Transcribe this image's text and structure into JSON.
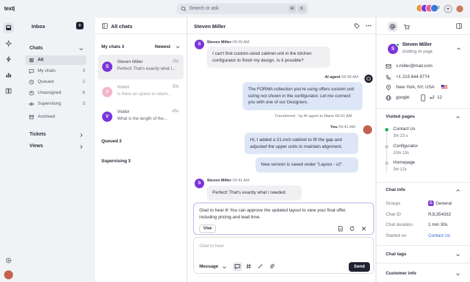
{
  "app": {
    "logo": "text|"
  },
  "search": {
    "placeholder": "Search or ask",
    "key1": "⌘",
    "key2": "K"
  },
  "topbar": {
    "online_count": "99",
    "add_label": "+"
  },
  "colors": {
    "accent": "#7b35d8",
    "send": "#1f2230",
    "visitor_pink": "#f3b6c9",
    "visitor_purple": "#7b35d8",
    "link": "#2a63d6",
    "green": "#1fb05a"
  },
  "rail_icons": [
    "inbox-icon",
    "sparkle-icon",
    "bolt-icon",
    "chart-icon",
    "book-icon",
    "settings-icon",
    "user-avatar"
  ],
  "nav": {
    "title": "Inbox",
    "chats_label": "Chats",
    "items": [
      {
        "label": "All",
        "count": "",
        "icon": "list-icon"
      },
      {
        "label": "My chats",
        "count": "3",
        "icon": "chat-icon"
      },
      {
        "label": "Queued",
        "count": "2",
        "icon": "clock-icon"
      },
      {
        "label": "Unassigned",
        "count": "6",
        "icon": "person-icon"
      },
      {
        "label": "Supervising",
        "count": "3",
        "icon": "eye-icon"
      },
      {
        "label": "Archived",
        "count": "",
        "icon": "archive-icon"
      }
    ],
    "tickets_label": "Tickets",
    "views_label": "Views"
  },
  "chat_list": {
    "title": "All chats",
    "my_chats_label": "My chats 3",
    "sort_label": "Newest",
    "cards": [
      {
        "initial": "S",
        "name": "Steven Miller",
        "time": "15s",
        "preview": "Perfect! That's exactly what I..."
      },
      {
        "initial": "V",
        "name": "Visitor",
        "time": "30s",
        "preview": "Is there an option to return..."
      },
      {
        "initial": "V",
        "name": "Visitor",
        "time": "45s",
        "preview": "What is the length of the..."
      }
    ],
    "queued_label": "Queued 2",
    "supervising_label": "Supervising 3"
  },
  "conversation": {
    "title": "Steven Miller",
    "messages": [
      {
        "initial": "S",
        "sender": "Steven Miller",
        "time": "09:39 AM",
        "text": "I can't find custom-sized cabinet unit in the kitchen configurator to finish my design. Is it possible?"
      },
      {
        "sender": "AI agent",
        "time": "09:39 AM",
        "text": "The FORMA collection you're using offers custom unit sizing not shown in the configurator. Let me connect you with one of our Designers."
      },
      {
        "transfer_note": "Transferred - by AI agent to Marie 09:41 AM"
      },
      {
        "sender": "You",
        "time": "09:41 AM",
        "text": "Hi, I added a 21-inch cabinet to fill the gap and adjusted the upper units to maintain alignment."
      },
      {
        "text": "New version is saved under \"Layout - v2\"."
      },
      {
        "initial": "S",
        "sender": "Steven Miller",
        "time": "09:42 AM",
        "text": "Perfect! That's exactly what I needed."
      }
    ],
    "suggestion": {
      "text": "Glad to hear it! You can approve the updated layout to view your final offer, including pricing and lead time.",
      "use_label": "Use"
    },
    "composer": {
      "placeholder": "Glad to hear",
      "mode_label": "Message",
      "send_label": "Send"
    }
  },
  "details": {
    "name": "Steven Miller",
    "status": "chatting on page",
    "initial": "S",
    "email": "s.miller@mail.com",
    "phone": "+1 215 844 9774",
    "location": "New York, NY, USA",
    "browser": "google",
    "visits": "12",
    "visited_pages_label": "Visited pages",
    "pages": [
      {
        "name": "Contact Us",
        "duration": "3m 23 s"
      },
      {
        "name": "Configurator",
        "duration": "10m 13s"
      },
      {
        "name": "Homepage",
        "duration": "3m 12s"
      }
    ],
    "chat_info_label": "Chat info",
    "info": [
      {
        "label": "Groups",
        "value": "General",
        "badge": "G"
      },
      {
        "label": "Chat ID",
        "value": "RJL354332"
      },
      {
        "label": "Chat duration",
        "value": "1 min 30s"
      },
      {
        "label": "Started on",
        "value": "Contact Us"
      }
    ],
    "chat_tags_label": "Chat tags",
    "customer_info_label": "Customer info"
  }
}
